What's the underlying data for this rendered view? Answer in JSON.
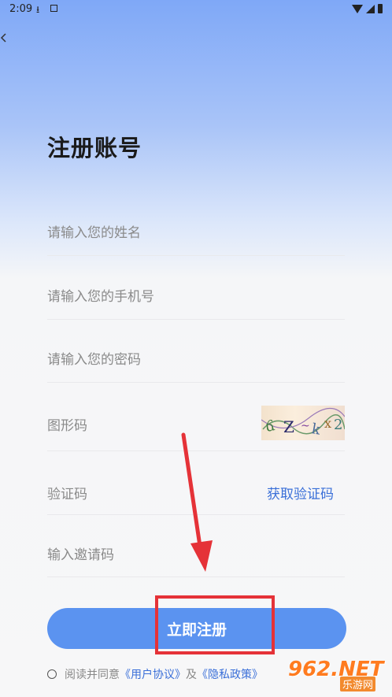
{
  "status": {
    "time": "2:09"
  },
  "header": {
    "back_icon": "chevron-left-icon"
  },
  "title": "注册账号",
  "fields": {
    "name_placeholder": "请输入您的姓名",
    "phone_placeholder": "请输入您的手机号",
    "password_placeholder": "请输入您的密码",
    "captcha_label": "图形码",
    "code_label": "验证码",
    "get_code_label": "获取验证码",
    "invite_placeholder": "输入邀请码"
  },
  "register_label": "立即注册",
  "agree": {
    "text": "阅读并同意",
    "user_agreement": "《用户协议》",
    "and": "及",
    "privacy_policy": "《隐私政策》"
  },
  "colors": {
    "accent": "#5b93f0",
    "link": "#3a6fd8",
    "annotation": "#e53238"
  },
  "watermark": {
    "number": "962.NET",
    "sub": "乐游网"
  }
}
